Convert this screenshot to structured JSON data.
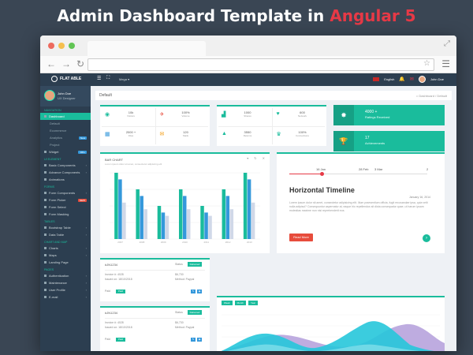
{
  "banner": {
    "title_main": "Admin Dashboard Template in",
    "title_accent": "Angular 5"
  },
  "header": {
    "logo": "FLAT ABLE",
    "dropdown": "Mega",
    "language": "English",
    "user": "John Doe"
  },
  "profile": {
    "name": "John Doe",
    "role": "UX Designer"
  },
  "sidebar": [
    {
      "type": "section",
      "label": "Navigation"
    },
    {
      "type": "item",
      "label": "Dashboard",
      "active": true
    },
    {
      "type": "sub",
      "label": "Default"
    },
    {
      "type": "sub",
      "label": "Ecommerce"
    },
    {
      "type": "sub",
      "label": "Analytics",
      "badge": "New",
      "badge_color": "#3498db"
    },
    {
      "type": "sub",
      "label": "Project"
    },
    {
      "type": "item",
      "label": "Widget",
      "badge": "100+",
      "badge_color": "#3498db"
    },
    {
      "type": "section",
      "label": "UI Element"
    },
    {
      "type": "item",
      "label": "Basic Components",
      "chev": true
    },
    {
      "type": "item",
      "label": "Advance Components",
      "chev": true
    },
    {
      "type": "item",
      "label": "Animations"
    },
    {
      "type": "section",
      "label": "Forms"
    },
    {
      "type": "item",
      "label": "Form Components",
      "chev": true
    },
    {
      "type": "item",
      "label": "Form Picker",
      "badge": "NEW",
      "badge_color": "#e74c3c"
    },
    {
      "type": "item",
      "label": "Form Select"
    },
    {
      "type": "item",
      "label": "Form Masking"
    },
    {
      "type": "section",
      "label": "Tables"
    },
    {
      "type": "item",
      "label": "Bootstrap Table",
      "chev": true
    },
    {
      "type": "item",
      "label": "Data Table",
      "chev": true
    },
    {
      "type": "section",
      "label": "Chart And Map"
    },
    {
      "type": "item",
      "label": "Charts",
      "chev": true
    },
    {
      "type": "item",
      "label": "Maps",
      "chev": true
    },
    {
      "type": "item",
      "label": "Landing Page"
    },
    {
      "type": "section",
      "label": "Pages"
    },
    {
      "type": "item",
      "label": "Authentication",
      "chev": true
    },
    {
      "type": "item",
      "label": "Maintenance",
      "chev": true
    },
    {
      "type": "item",
      "label": "User Profile",
      "chev": true
    },
    {
      "type": "item",
      "label": "E-mail",
      "chev": true
    }
  ],
  "breadcrumb": {
    "title": "Default",
    "path": "Dashboard / Default"
  },
  "stats": {
    "card1": [
      {
        "icon": "eye-icon",
        "color": "#1abc9c",
        "value": "10k",
        "label": "Visitors"
      },
      {
        "icon": "sales-icon",
        "color": "#e74c3c",
        "value": "100%",
        "label": "Volume"
      },
      {
        "icon": "files-icon",
        "color": "#3498db",
        "value": "2000 +",
        "label": "Files"
      },
      {
        "icon": "mail-icon",
        "color": "#f39c12",
        "value": "120",
        "label": "Mails"
      }
    ],
    "card2": [
      {
        "icon": "bar-chart-icon",
        "color": "#1abc9c",
        "value": "1000",
        "label": "Shares"
      },
      {
        "icon": "thumbs-up-icon",
        "color": "#1abc9c",
        "value": "600",
        "label": "Network"
      },
      {
        "icon": "area-chart-icon",
        "color": "#1abc9c",
        "value": "3550",
        "label": "Returns"
      },
      {
        "icon": "trophy-icon",
        "color": "#1abc9c",
        "value": "100%",
        "label": "Connections"
      }
    ]
  },
  "green_cards": [
    {
      "value": "4000 +",
      "label": "Ratings Received",
      "icon": "star-icon"
    },
    {
      "value": "17",
      "label": "Achievements",
      "icon": "trophy-icon"
    }
  ],
  "bar_panel": {
    "title": "BAR CHART",
    "subtitle": "Lorem ipsum dolor sit amet, consectetur adipiscing elit"
  },
  "chart_data": {
    "type": "bar",
    "categories": [
      "2007",
      "2008",
      "2009",
      "2010",
      "2011",
      "2012",
      "2013"
    ],
    "series": [
      {
        "values": [
          100,
          75,
          50,
          75,
          50,
          75,
          100
        ],
        "color": "#1abc9c"
      },
      {
        "values": [
          90,
          65,
          40,
          65,
          40,
          65,
          90
        ],
        "color": "#3498db"
      },
      {
        "values": [
          55,
          45,
          35,
          45,
          35,
          45,
          55
        ],
        "color": "#d0d8e8"
      }
    ],
    "ylim": [
      0,
      100
    ]
  },
  "timeline": {
    "labels": [
      "16 Jan",
      "28 Feb",
      "3 Mar",
      "2"
    ],
    "heading": "Horizontal Timeline",
    "date": "January 16, 2014",
    "text": "Lorem ipsum dolor sit amet, consectetur adipisicing elit. Illum praesentium officia, fugit recusandae ipsa, quia velit nulla adipisci? Consequuntur aspernatur at, eaque hic repellendus sit dicta consequatur quae, ut harum ipsam molestias maxime non nisi reprehenderit eos.",
    "button": "Read More"
  },
  "orders": [
    {
      "id": "#JN1234",
      "status_label": "Status",
      "status": "Delivered",
      "order": "Invoice #: 4028",
      "location": "Issued on: 18/10/2018",
      "amount": "$6,730",
      "method": "Method: Paypal",
      "paid_label": "Paid",
      "paid": "Paid"
    },
    {
      "id": "#JN1234",
      "status_label": "Status",
      "status": "Delivered",
      "order": "Invoice #: 4028",
      "location": "Issued on: 18/10/2018",
      "amount": "$6,730",
      "method": "Method: Paypal",
      "paid_label": "Paid",
      "paid": "Paid"
    }
  ],
  "area_panel": {
    "buttons": [
      "Week",
      "Month",
      "Year"
    ]
  }
}
